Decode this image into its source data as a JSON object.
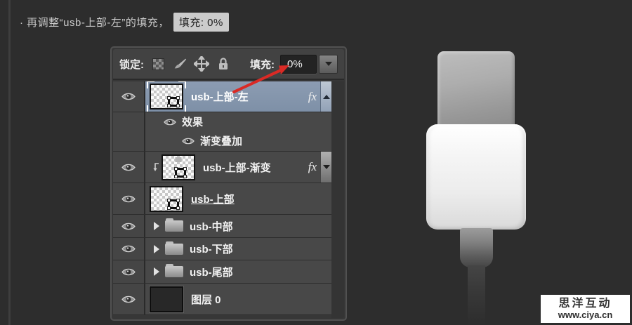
{
  "instruction": {
    "prefix": "· 再调整“usb-上部-左”的填充，",
    "highlight": "填充: 0%"
  },
  "layers_panel": {
    "lock_label": "锁定:",
    "fill_label": "填充:",
    "fill_value": "0%",
    "fx_label": "fx",
    "layers": [
      {
        "name": "usb-上部-左",
        "selected": true,
        "has_fx": true
      },
      {
        "name": "usb-上部-渐变",
        "has_fx": true,
        "clipped": true
      },
      {
        "name": "usb-上部",
        "underlined": true
      },
      {
        "name": "usb-中部",
        "type": "group"
      },
      {
        "name": "usb-下部",
        "type": "group"
      },
      {
        "name": "usb-尾部",
        "type": "group"
      },
      {
        "name": "图层 0"
      }
    ],
    "effects": {
      "title": "效果",
      "items": [
        "渐变叠加"
      ]
    },
    "icons": [
      "lock-transparency-checker",
      "lock-pixels-brush",
      "lock-position-move",
      "lock-all-padlock",
      "eye-visibility",
      "folder-group",
      "clipping-mask-arrow",
      "chevron-down",
      "chevron-up"
    ]
  },
  "watermark": {
    "line1": "思洋互动",
    "line2": "www.ciya.cn"
  },
  "colors": {
    "page_bg": "#2d2d2d",
    "panel_bg": "#373737",
    "row_bg": "#484848",
    "selected_row": "#8495ac",
    "highlight_box": "#cbcbcb",
    "annotation_arrow": "#da2a25"
  }
}
